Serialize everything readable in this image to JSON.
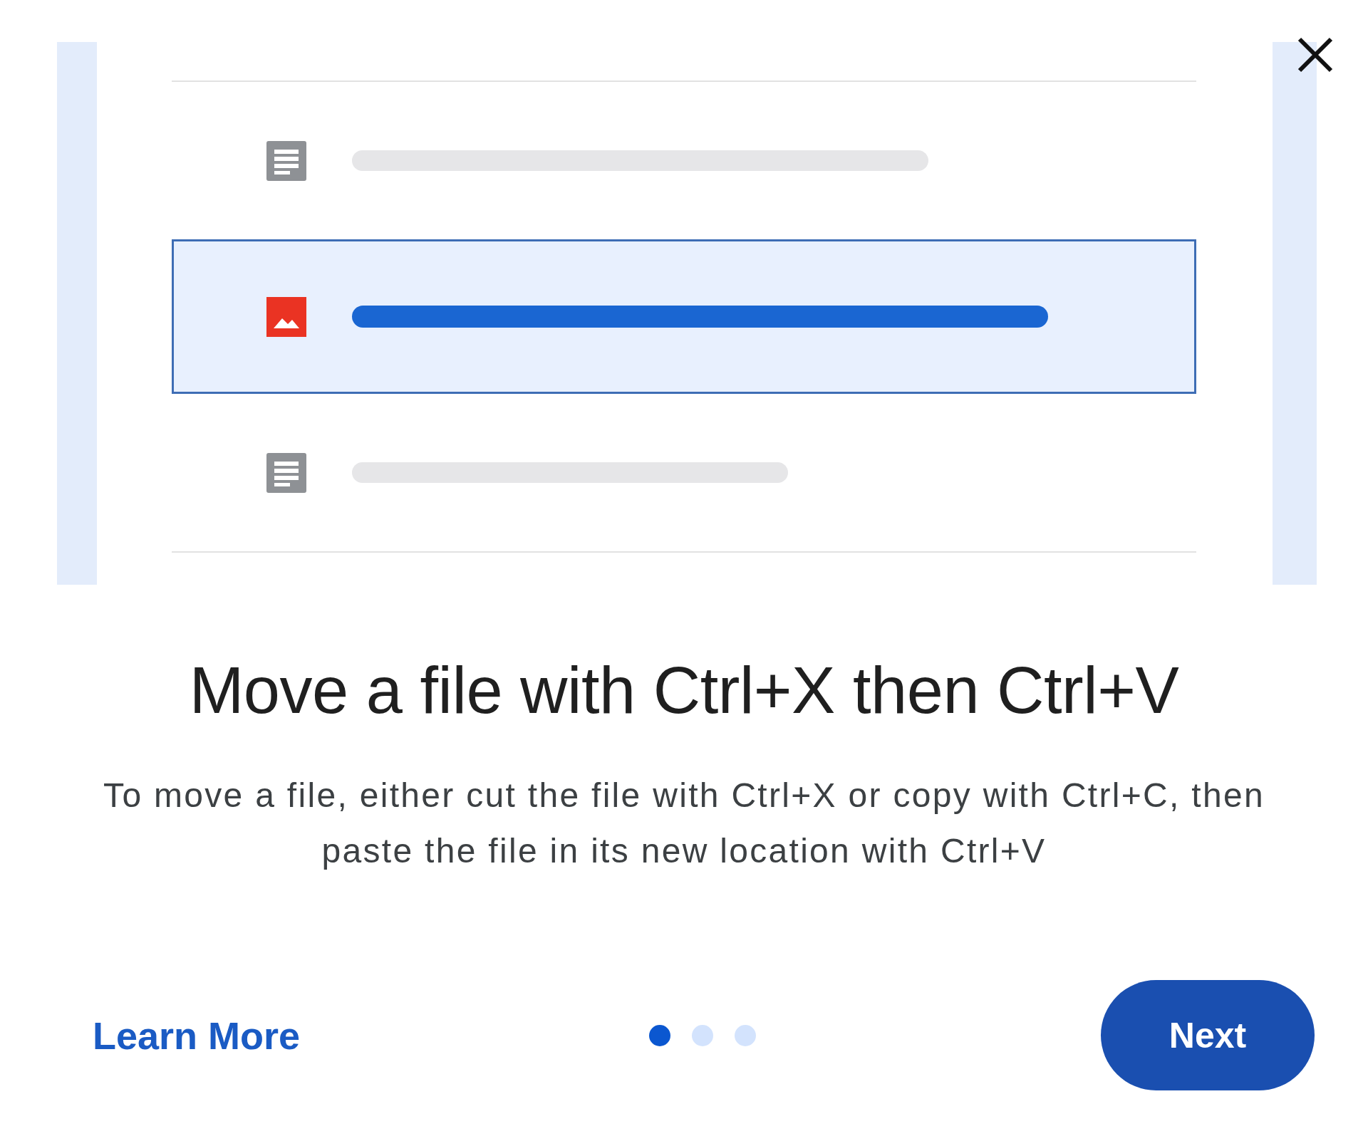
{
  "illustration": {
    "rows": [
      {
        "kind": "document",
        "selected": false
      },
      {
        "kind": "image",
        "selected": true
      },
      {
        "kind": "document",
        "selected": false
      }
    ]
  },
  "title": "Move a file with Ctrl+X then Ctrl+V",
  "description": "To move a file, either cut the file with Ctrl+X or copy with Ctrl+C, then paste the file in its new location with Ctrl+V",
  "footer": {
    "link": "Learn More",
    "dots": [
      {
        "selected": true
      },
      {
        "selected": false
      },
      {
        "selected": false
      }
    ],
    "button": "Next"
  }
}
